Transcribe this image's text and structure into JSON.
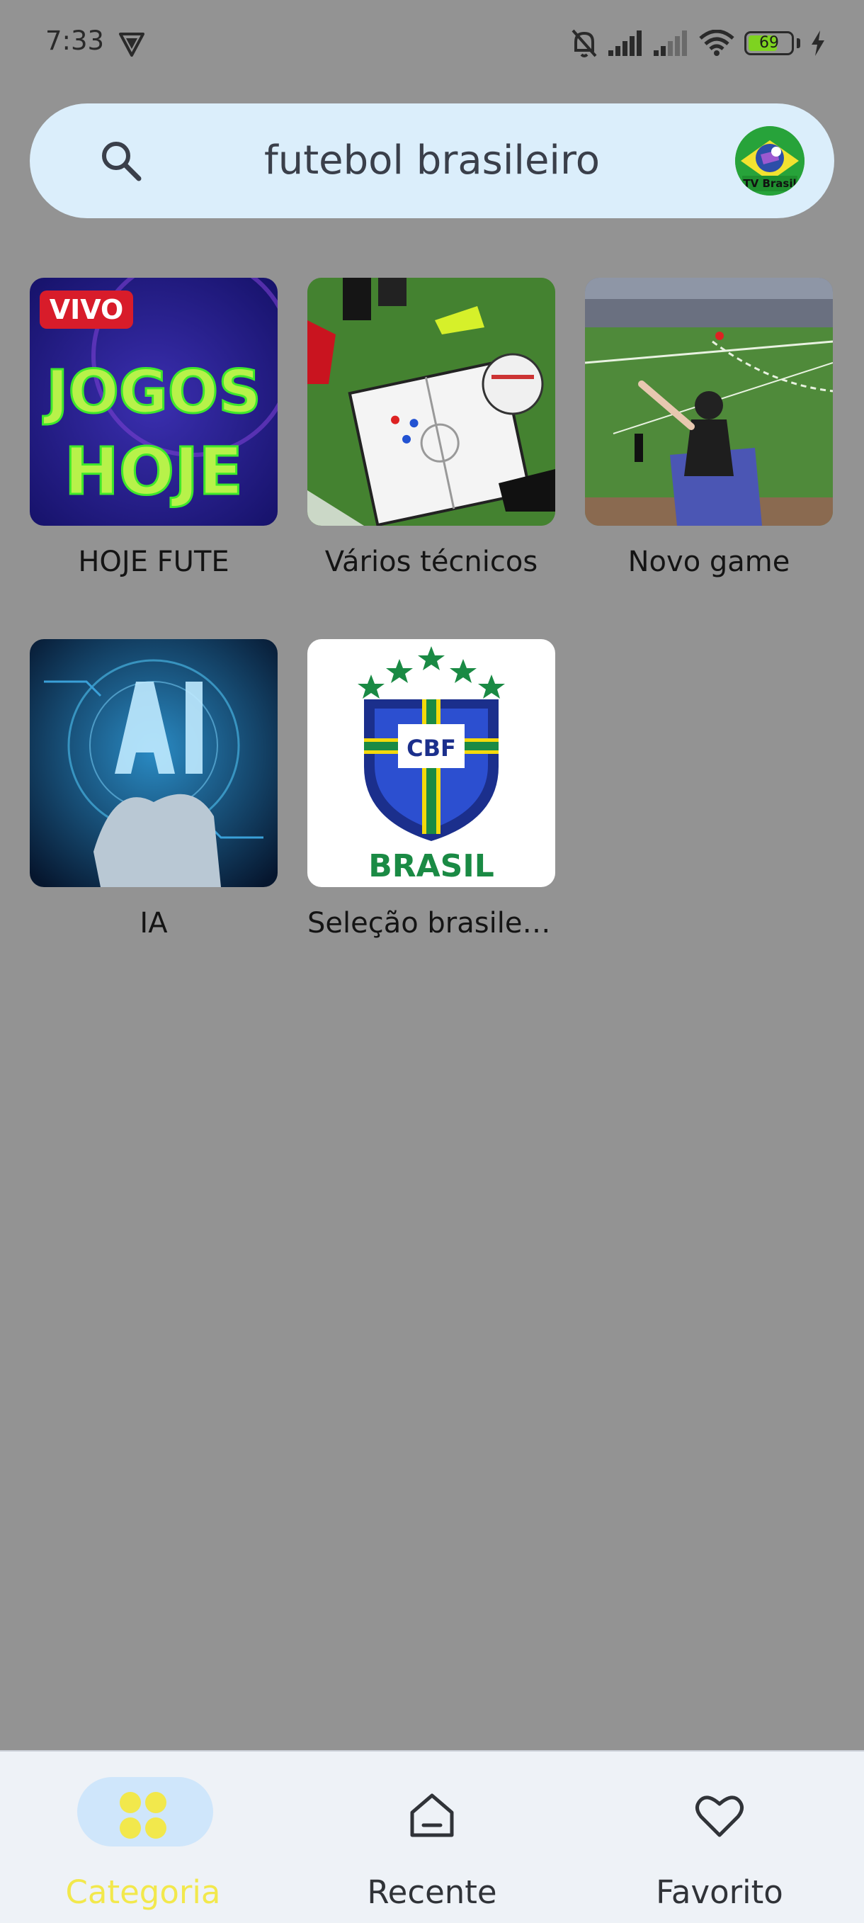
{
  "status_bar": {
    "time": "7:33",
    "battery_level": "69",
    "battery_fraction": 0.69,
    "icons": [
      "vpn-icon",
      "mute-bell-icon",
      "signal-icon",
      "signal-weak-icon",
      "wifi-icon",
      "battery-icon",
      "charging-icon"
    ]
  },
  "search": {
    "query": "futebol brasileiro",
    "icon": "search-icon",
    "avatar_label": "TV Brasil"
  },
  "categories": [
    {
      "label": "HOJE FUTE",
      "thumb_text_top": "VIVO",
      "thumb_text_1": "JOGOS",
      "thumb_text_2": "HOJE"
    },
    {
      "label": "Vários técnicos"
    },
    {
      "label": "Novo game"
    },
    {
      "label": "IA"
    },
    {
      "label": "Seleção brasileira",
      "thumb_text_top": "CBF",
      "thumb_text_1": "BRASIL"
    }
  ],
  "bottom_nav": {
    "items": [
      {
        "label": "Categoria",
        "icon": "grid-icon",
        "active": true
      },
      {
        "label": "Recente",
        "icon": "home-icon",
        "active": false
      },
      {
        "label": "Favorito",
        "icon": "heart-icon",
        "active": false
      }
    ]
  },
  "colors": {
    "background": "#939393",
    "search_bg": "#dbeefb",
    "nav_bg": "#eef2f7",
    "active_accent": "#f2e84c",
    "active_pill": "#cfe6fb"
  }
}
